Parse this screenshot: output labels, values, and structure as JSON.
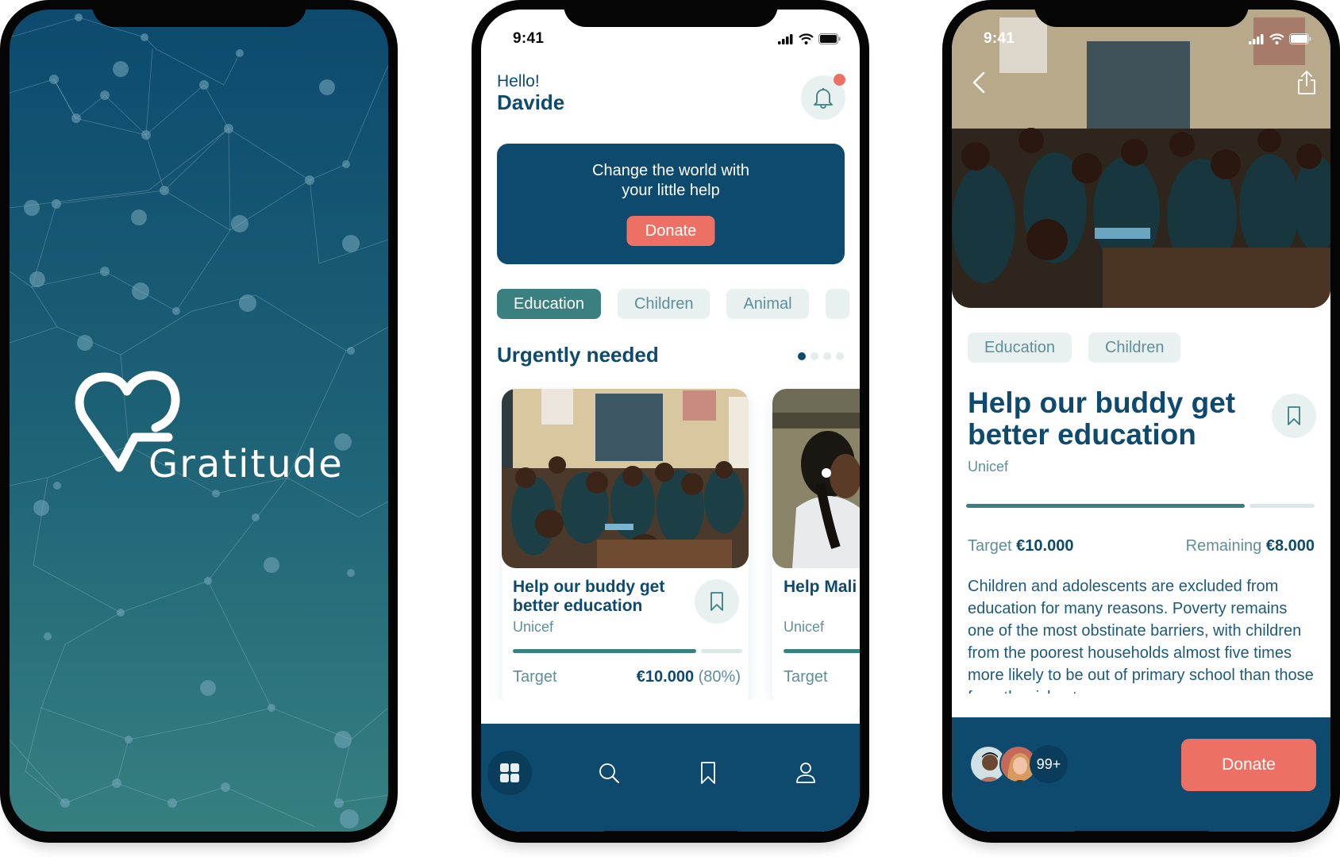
{
  "colors": {
    "primary": "#0d4a6e",
    "teal": "#3a8080",
    "coral": "#ec7063",
    "chip_bg": "#e9f0f0",
    "muted_text": "#5e8f98"
  },
  "splash": {
    "logo_text": "Gratitude",
    "logo_icon": "heart-icon"
  },
  "status_bar": {
    "time": "9:41",
    "icons": [
      "signal-icon",
      "wifi-icon",
      "battery-icon"
    ]
  },
  "home": {
    "greeting": "Hello!",
    "user_name": "Davide",
    "notification_icon": "bell-icon",
    "has_notification": true,
    "banner": {
      "message": "Change the world with your little help",
      "button_label": "Donate"
    },
    "categories": [
      {
        "label": "Education",
        "active": true
      },
      {
        "label": "Children",
        "active": false
      },
      {
        "label": "Animal",
        "active": false
      }
    ],
    "section_title": "Urgently needed",
    "pager": {
      "total": 4,
      "current": 1
    },
    "cards": [
      {
        "title": "Help our buddy get better education",
        "organization": "Unicef",
        "target_label": "Target",
        "target_value": "€10.000",
        "progress_text": "(80%)",
        "progress": 0.8
      },
      {
        "title": "Help Mali family",
        "organization": "Unicef",
        "target_label": "Target",
        "progress": 0.8
      }
    ],
    "tabs": [
      {
        "name": "home",
        "icon": "grid-icon",
        "active": true
      },
      {
        "name": "search",
        "icon": "search-icon",
        "active": false
      },
      {
        "name": "saved",
        "icon": "bookmark-icon",
        "active": false
      },
      {
        "name": "profile",
        "icon": "user-icon",
        "active": false
      }
    ]
  },
  "detail": {
    "tags": [
      "Education",
      "Children"
    ],
    "title": "Help our buddy get better education",
    "organization": "Unicef",
    "progress": 0.8,
    "target_label": "Target",
    "target_value": "€10.000",
    "remaining_label": "Remaining",
    "remaining_value": "€8.000",
    "description": "Children and adolescents are excluded from education for many reasons. Poverty remains one of the most obstinate barriers, with children from the poorest households almost five times more likely to be out of primary school than those from the richest.",
    "donors_count": "99+",
    "donate_label": "Donate"
  }
}
